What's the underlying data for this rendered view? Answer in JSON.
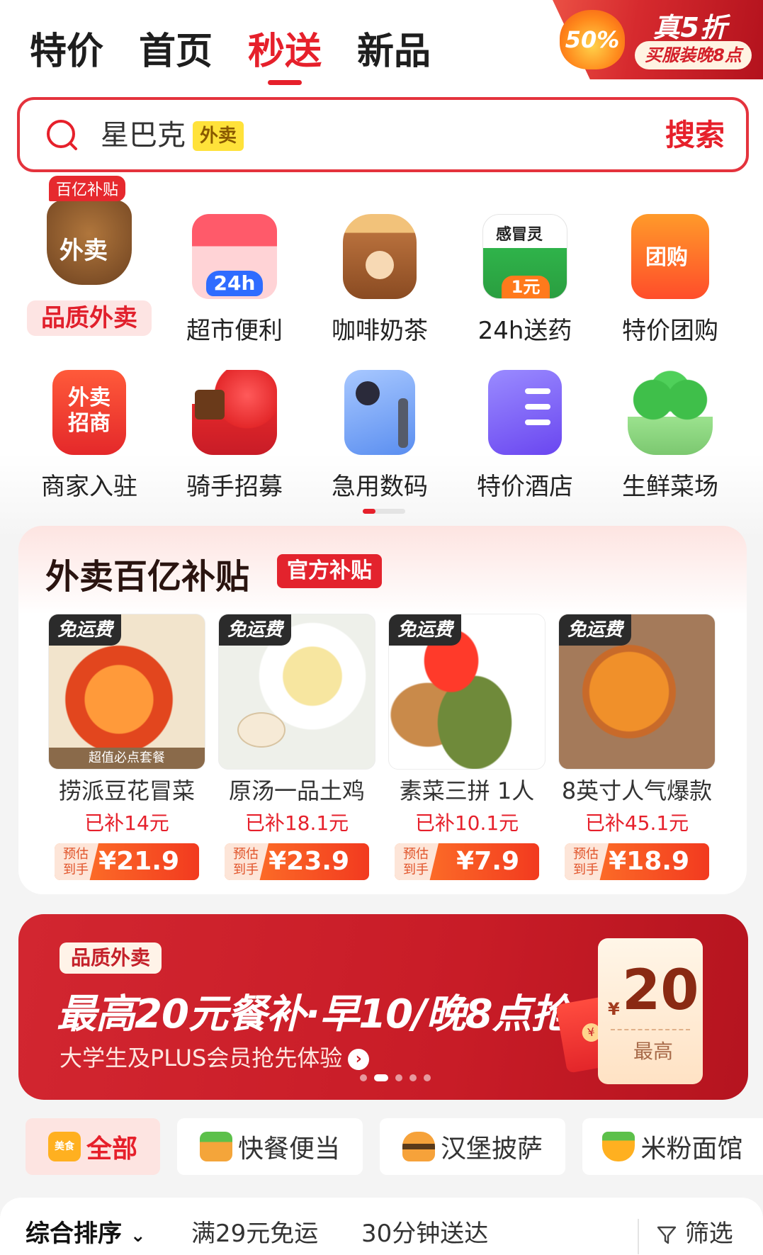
{
  "top_tabs": [
    {
      "label": "特价"
    },
    {
      "label": "首页"
    },
    {
      "label": "秒送"
    },
    {
      "label": "新品"
    }
  ],
  "promo": {
    "badge": "50%",
    "title": "真5折",
    "subtitle": "买服装晚8点"
  },
  "search": {
    "query": "星巴克",
    "tag": "外卖",
    "button_label": "搜索"
  },
  "categories": [
    {
      "label": "品质外卖",
      "icon": "takeout-bag-icon",
      "tag": "百亿补贴",
      "icon_text": "外卖"
    },
    {
      "label": "超市便利",
      "icon": "store-24h-icon",
      "icon_text": "24h"
    },
    {
      "label": "咖啡奶茶",
      "icon": "coffee-cup-icon"
    },
    {
      "label": "24h送药",
      "icon": "medicine-box-icon",
      "icon_text": "感冒灵",
      "icon_price": "1元"
    },
    {
      "label": "特价团购",
      "icon": "group-buy-ticket-icon",
      "icon_text": "团购"
    },
    {
      "label": "商家入驻",
      "icon": "merchant-bag-icon",
      "icon_text": "外卖招商"
    },
    {
      "label": "骑手招募",
      "icon": "rider-scooter-icon"
    },
    {
      "label": "急用数码",
      "icon": "phone-cable-icon"
    },
    {
      "label": "特价酒店",
      "icon": "hotel-building-icon"
    },
    {
      "label": "生鲜菜场",
      "icon": "broccoli-icon"
    }
  ],
  "subsidy": {
    "title": "外卖百亿补贴",
    "tag": "官方补贴",
    "products": [
      {
        "badge": "免运费",
        "name": "捞派豆花冒菜",
        "subsidy": "已补14元",
        "price_label": "预估到手",
        "price": "¥21.9",
        "img_caption": "超值必点套餐"
      },
      {
        "badge": "免运费",
        "name": "原汤一品土鸡",
        "subsidy": "已补18.1元",
        "price_label": "预估到手",
        "price": "¥23.9"
      },
      {
        "badge": "免运费",
        "name": "素菜三拼 1人",
        "subsidy": "已补10.1元",
        "price_label": "预估到手",
        "price": "¥7.9"
      },
      {
        "badge": "免运费",
        "name": "8英寸人气爆款",
        "subsidy": "已补45.1元",
        "price_label": "预估到手",
        "price": "¥18.9"
      }
    ]
  },
  "banner": {
    "tag": "品质外卖",
    "title": "最高20元餐补·早10/晚8点抢",
    "subtitle": "大学生及PLUS会员抢先体验",
    "coupon_currency": "¥",
    "coupon_amount": "20",
    "coupon_label": "最高"
  },
  "chips": [
    {
      "label": "全部",
      "icon_text": "美食"
    },
    {
      "label": "快餐便当"
    },
    {
      "label": "汉堡披萨"
    },
    {
      "label": "米粉面馆"
    }
  ],
  "filters": {
    "sort": "综合排序",
    "free_delivery": "满29元免运",
    "fast": "30分钟送达",
    "filter": "筛选"
  }
}
